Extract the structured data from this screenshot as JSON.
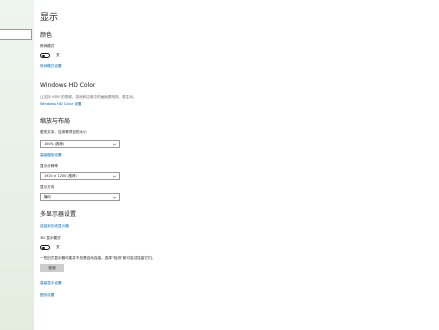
{
  "sidebar": {
    "search_value": ""
  },
  "page": {
    "title": "显示"
  },
  "color": {
    "heading": "颜色",
    "night_light_label": "夜间模式",
    "night_light_state": "关",
    "night_light_link": "夜间模式设置"
  },
  "hdr": {
    "heading": "Windows HD Color",
    "description": "让支持 HDR 的视频、游戏和应用中的画面更明亮、更生动。",
    "link": "Windows HD Color 设置"
  },
  "scale": {
    "heading": "缩放与布局",
    "text_size_label": "更改文本、应用等项目的大小",
    "text_size_value": "100% (推荐)",
    "advanced_link": "高级缩放设置",
    "resolution_label": "显示分辨率",
    "resolution_value": "1920 × 1200 (推荐)",
    "orientation_label": "显示方向",
    "orientation_value": "横向"
  },
  "multi": {
    "heading": "多显示器设置",
    "wireless_link": "连接到无线显示器",
    "hologram_label": "3D 显示模式",
    "hologram_state": "关",
    "note": "一些旧式显示器可能并不总是自动连接。选择“检测”即可尝试连接它们。",
    "detect_label": "检测",
    "advanced_display_link": "高级显示设置",
    "graphics_link": "图形设置"
  },
  "colors": {
    "accent": "#0063b1",
    "sidebar_bg": "#e8f1e7",
    "button_bg": "#cccccc"
  },
  "icons": {
    "dropdown": "chevron-down-icon"
  }
}
